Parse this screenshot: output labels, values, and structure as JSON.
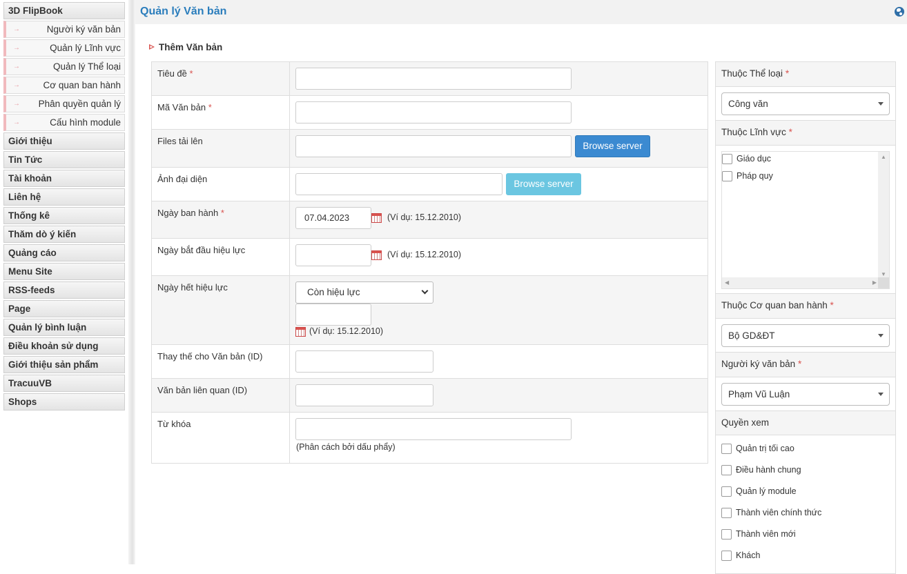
{
  "sidebar": {
    "items": [
      {
        "label": "3D FlipBook",
        "type": "main"
      },
      {
        "label": "Người ký văn bản",
        "type": "sub"
      },
      {
        "label": "Quản lý Lĩnh vực",
        "type": "sub"
      },
      {
        "label": "Quản lý Thể loại",
        "type": "sub"
      },
      {
        "label": "Cơ quan ban hành",
        "type": "sub"
      },
      {
        "label": "Phân quyền quản lý",
        "type": "sub"
      },
      {
        "label": "Cấu hình module",
        "type": "sub"
      },
      {
        "label": "Giới thiệu",
        "type": "main"
      },
      {
        "label": "Tin Tức",
        "type": "main"
      },
      {
        "label": "Tài khoản",
        "type": "main"
      },
      {
        "label": "Liên hệ",
        "type": "main"
      },
      {
        "label": "Thống kê",
        "type": "main"
      },
      {
        "label": "Thăm dò ý kiến",
        "type": "main"
      },
      {
        "label": "Quảng cáo",
        "type": "main"
      },
      {
        "label": "Menu Site",
        "type": "main"
      },
      {
        "label": "RSS-feeds",
        "type": "main"
      },
      {
        "label": "Page",
        "type": "main"
      },
      {
        "label": "Quản lý bình luận",
        "type": "main"
      },
      {
        "label": "Điều khoản sử dụng",
        "type": "main"
      },
      {
        "label": "Giới thiệu sản phẩm",
        "type": "main"
      },
      {
        "label": "TracuuVB",
        "type": "main"
      },
      {
        "label": "Shops",
        "type": "main"
      }
    ],
    "sub_arrow": "→"
  },
  "header": {
    "title": "Quản lý Văn bản"
  },
  "section": {
    "title": "Thêm Văn bản"
  },
  "form": {
    "required_mark": "*",
    "title_label": "Tiêu đề",
    "title_value": "",
    "code_label": "Mã Văn bản",
    "code_value": "",
    "files_label": "Files tải lên",
    "files_value": "",
    "files_button": "Browse server",
    "image_label": "Ảnh đại diện",
    "image_value": "",
    "image_button": "Browse server",
    "issue_date_label": "Ngày ban hành",
    "issue_date_value": "07.04.2023",
    "date_hint": "(Ví dụ: 15.12.2010)",
    "start_date_label": "Ngày bắt đầu hiệu lực",
    "start_date_value": "",
    "end_date_label": "Ngày hết hiệu lực",
    "end_date_select": "Còn hiệu lực",
    "end_date_value": "",
    "replace_label": "Thay thế cho Văn bản (ID)",
    "replace_value": "",
    "related_label": "Văn bản liên quan (ID)",
    "related_value": "",
    "keywords_label": "Từ khóa",
    "keywords_value": "",
    "keywords_hint": "(Phân cách bởi dấu phẩy)"
  },
  "right_panel": {
    "category_label": "Thuộc Thể loại",
    "category_value": "Công văn",
    "field_label": "Thuộc Lĩnh vực",
    "fields": [
      {
        "label": "Giáo dục",
        "checked": false
      },
      {
        "label": "Pháp quy",
        "checked": false
      }
    ],
    "agency_label": "Thuộc Cơ quan ban hành",
    "agency_value": "Bộ GD&ĐT",
    "signer_label": "Người ký văn bản",
    "signer_value": "Phạm Vũ Luận",
    "view_label": "Quyền xem",
    "view_rights": [
      {
        "label": "Quản trị tối cao",
        "checked": false
      },
      {
        "label": "Điều hành chung",
        "checked": false
      },
      {
        "label": "Quản lý module",
        "checked": false
      },
      {
        "label": "Thành viên chính thức",
        "checked": false
      },
      {
        "label": "Thành viên mới",
        "checked": false
      },
      {
        "label": "Khách",
        "checked": false
      }
    ]
  },
  "colors": {
    "title": "#2a7dbc",
    "primary_button": "#3b8ad1",
    "info_button": "#5bc0de",
    "required": "#d9534f"
  }
}
